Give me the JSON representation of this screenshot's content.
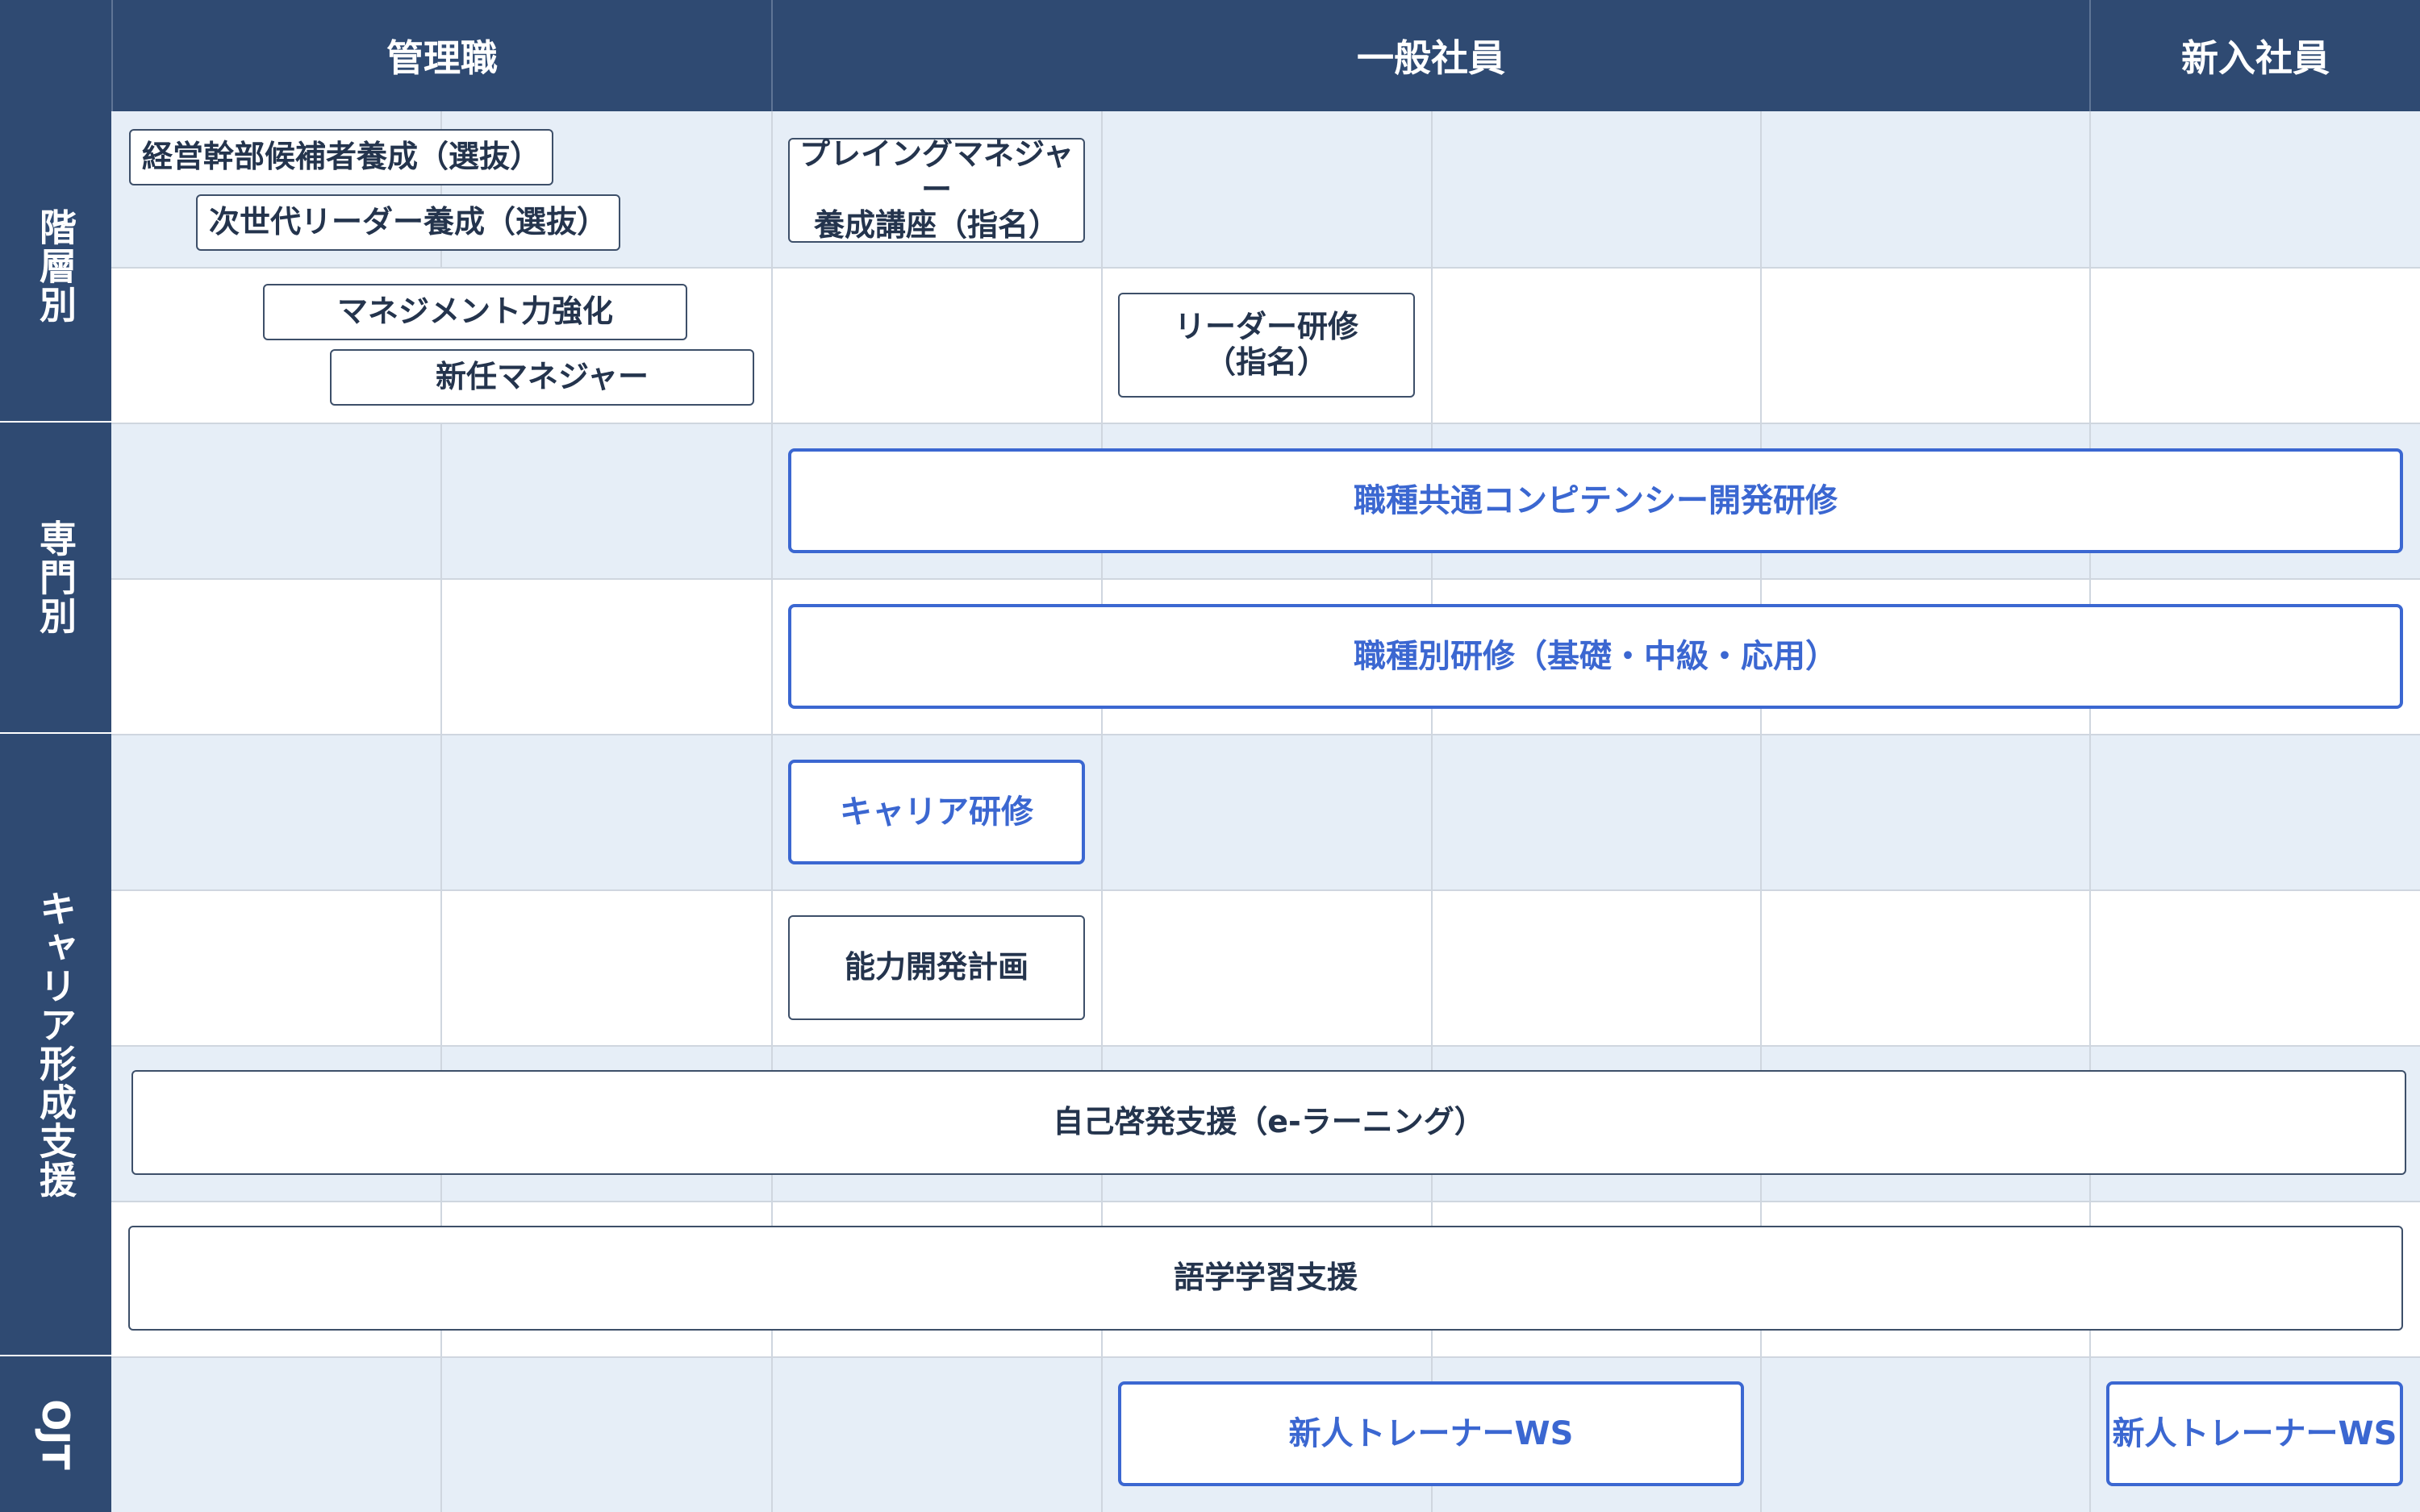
{
  "columns": {
    "corner": "",
    "management": "管理職",
    "general": "一般社員",
    "new_hire": "新入社員"
  },
  "categories": {
    "hierarchy": "階層別",
    "specialty": "専門別",
    "career": "キャリア形成支援",
    "ojt": "OJT"
  },
  "programs": {
    "executive_candidate": "経営幹部候補者養成（選抜）",
    "next_gen_leader": "次世代リーダー養成（選抜）",
    "management_strength": "マネジメント力強化",
    "new_manager": "新任マネジャー",
    "playing_manager": "プレイングマネジャー\n養成講座（指名）",
    "leader_training": "リーダー研修\n（指名）",
    "competency": "職種共通コンピテンシー開発研修",
    "job_specific": "職種別研修（基礎・中級・応用）",
    "career_training": "キャリア研修",
    "capability_plan": "能力開発計画",
    "elearning": "自己啓発支援（e-ラーニング）",
    "language": "語学学習支援",
    "trainer_ws_1": "新人トレーナーWS",
    "trainer_ws_2": "新人トレーナーWS"
  },
  "colors": {
    "header_navy": "#2f4a72",
    "row_shade": "#e6eef7",
    "grid_line": "#cfd6df",
    "accent_blue": "#3b67d1",
    "dark_text": "#24344d"
  }
}
